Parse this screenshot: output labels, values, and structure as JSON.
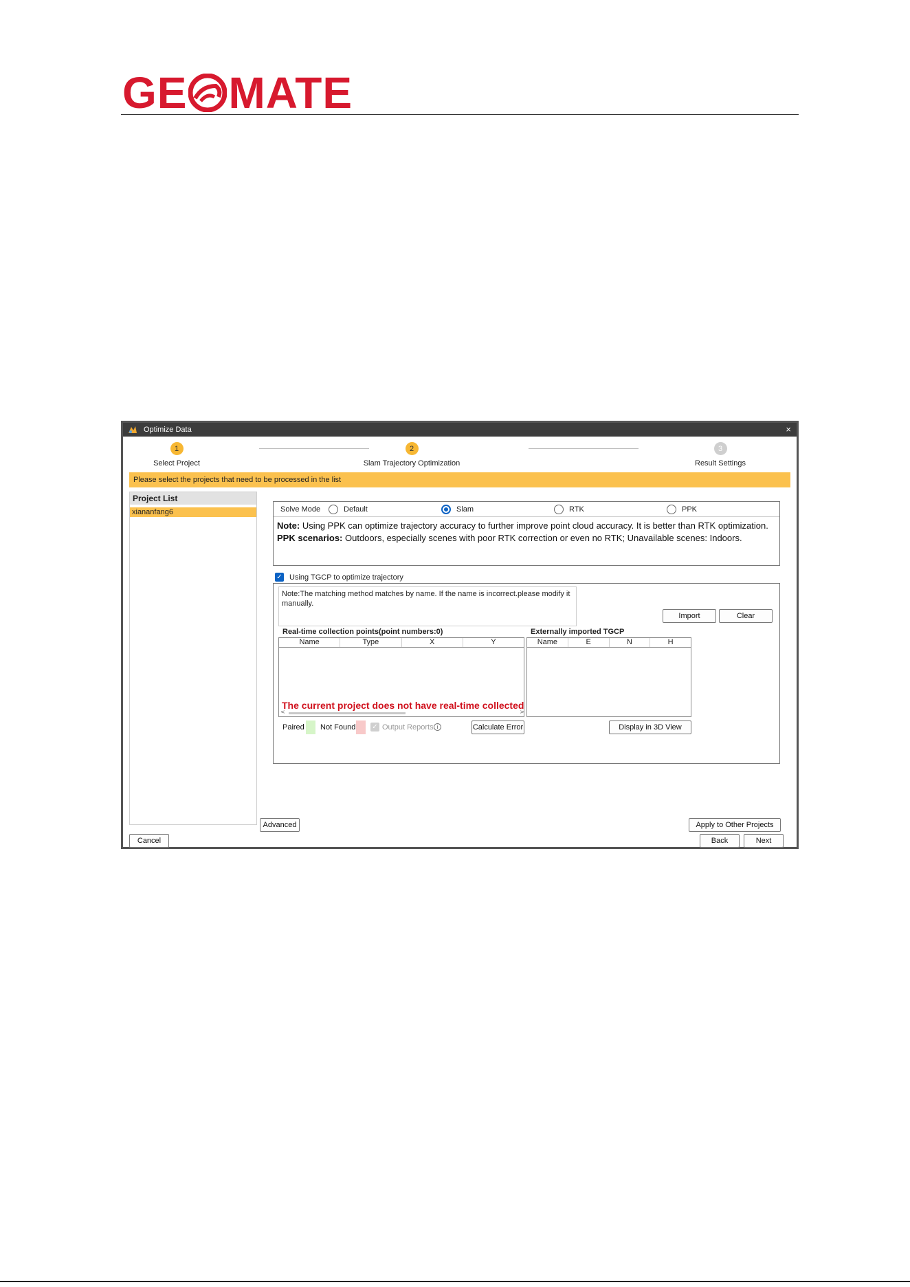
{
  "logo": {
    "text_left": "GE",
    "text_right": "MATE",
    "color": "#d7192e"
  },
  "window": {
    "title": "Optimize Data",
    "close": "×",
    "steps": [
      {
        "num": "1",
        "label": "Select Project"
      },
      {
        "num": "2",
        "label": "Slam Trajectory Optimization"
      },
      {
        "num": "3",
        "label": "Result Settings"
      }
    ],
    "banner": "Please select the projects that need to be processed in the list",
    "project_list": {
      "header": "Project List",
      "items": [
        "xiananfang6"
      ]
    },
    "solve_mode": {
      "label": "Solve Mode",
      "options": [
        "Default",
        "Slam",
        "RTK",
        "PPK"
      ],
      "selected": "Slam",
      "note_label": "Note:",
      "note_text": " Using PPK can optimize trajectory accuracy to further improve point cloud accuracy. It is better than RTK optimization.",
      "scenarios_label": "PPK scenarios:",
      "scenarios_text": " Outdoors, especially scenes with poor RTK correction or even no RTK; Unavailable scenes: Indoors."
    },
    "tgcp": {
      "checkbox_label": "Using TGCP to optimize trajectory",
      "note": "Note:The matching method matches by name. If the name is incorrect.please modify it manually.",
      "import_label": "Import",
      "clear_label": "Clear",
      "realtime_title": "Real-time collection points(point numbers:0)",
      "realtime_columns": [
        "Name",
        "Type",
        "X",
        "Y"
      ],
      "realtime_empty": "The current project does not have real-time collected points.",
      "external_title": "Externally imported TGCP",
      "external_columns": [
        "Name",
        "E",
        "N",
        "H"
      ],
      "paired_label": "Paired",
      "notfound_label": "Not Found",
      "output_reports_label": "Output Reports",
      "calculate_error_label": "Calculate Error",
      "display_3d_label": "Display in 3D View",
      "paired_color": "#d6f5c8",
      "notfound_color": "#f8c9c9"
    },
    "buttons": {
      "advanced": "Advanced",
      "apply_other": "Apply to Other Projects",
      "cancel": "Cancel",
      "back": "Back",
      "next": "Next"
    }
  }
}
